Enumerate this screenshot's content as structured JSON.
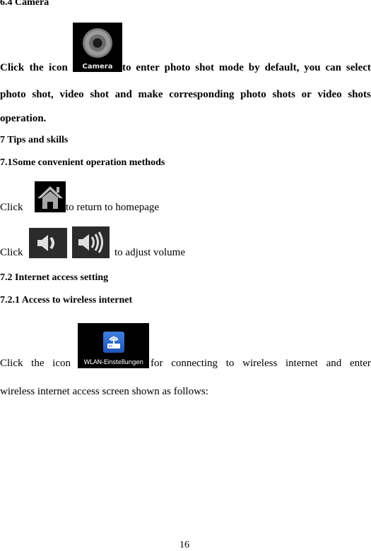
{
  "sections": {
    "camera_heading": "6.4 Camera",
    "camera_para": {
      "line1_before": [
        "Click",
        "the",
        "icon"
      ],
      "line1_after": [
        "to",
        "enter",
        "photo",
        "shot",
        "mode",
        "by",
        "default,",
        "you",
        "can",
        "select"
      ],
      "line2": [
        "photo",
        "shot,",
        "video",
        "shot",
        "and",
        "make",
        "corresponding",
        "photo",
        "shots",
        "or",
        "video",
        "shots"
      ],
      "line3": "operation."
    },
    "tips_heading": "7 Tips and skills",
    "methods_heading": "7.1Some convenient operation methods",
    "home_line": {
      "click": "Click",
      "text": "to return to homepage"
    },
    "volume_line": {
      "click": "Click",
      "text": "to adjust volume"
    },
    "internet_heading": "7.2 Internet access setting",
    "wireless_heading": "7.2.1 Access to wireless internet",
    "wlan_para": {
      "line1_before": [
        "Click",
        "the",
        "icon"
      ],
      "line1_after": [
        "for",
        "connecting",
        "to",
        "wireless",
        "internet",
        "and",
        "enter"
      ],
      "line2": "wireless internet access screen shown as follows:"
    }
  },
  "icons": {
    "camera": {
      "label": "Camera"
    },
    "home": {
      "name": "home"
    },
    "volume_down": {
      "name": "volume-down"
    },
    "volume_up": {
      "name": "volume-up"
    },
    "wlan": {
      "label": "WLAN-Einstellungen",
      "color": "#2f6bd0"
    }
  },
  "footer": {
    "page_number": "16"
  }
}
